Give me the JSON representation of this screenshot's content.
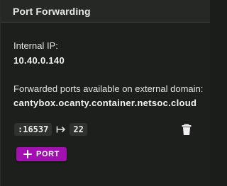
{
  "panel": {
    "title": "Port Forwarding"
  },
  "internal_ip": {
    "label": "Internal IP:",
    "value": "10.40.0.140"
  },
  "external_domain": {
    "label": "Forwarded ports available on external domain:",
    "value": "cantybox.ocanty.container.netsoc.cloud"
  },
  "port_mappings": [
    {
      "external": ":16537",
      "internal": "22"
    }
  ],
  "add_port_button": {
    "label": "PORT",
    "color": "#a310b0"
  },
  "icons": {
    "mapping_arrow": "mapsto-arrow-icon",
    "delete": "trash-icon",
    "add": "plus-icon"
  }
}
